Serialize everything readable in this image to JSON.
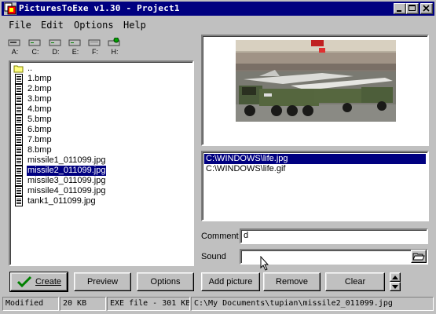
{
  "window": {
    "title": "PicturesToExe v1.30 - Project1"
  },
  "menu": {
    "items": [
      "File",
      "Edit",
      "Options",
      "Help"
    ]
  },
  "drives": [
    "A:",
    "C:",
    "D:",
    "E:",
    "F:",
    "H:"
  ],
  "files": [
    {
      "name": "..",
      "type": "folder"
    },
    {
      "name": "1.bmp",
      "type": "file"
    },
    {
      "name": "2.bmp",
      "type": "file"
    },
    {
      "name": "3.bmp",
      "type": "file"
    },
    {
      "name": "4.bmp",
      "type": "file"
    },
    {
      "name": "5.bmp",
      "type": "file"
    },
    {
      "name": "6.bmp",
      "type": "file"
    },
    {
      "name": "7.bmp",
      "type": "file"
    },
    {
      "name": "8.bmp",
      "type": "file"
    },
    {
      "name": "missile1_011099.jpg",
      "type": "file"
    },
    {
      "name": "missile2_011099.jpg",
      "type": "file",
      "selected": true
    },
    {
      "name": "missile3_011099.jpg",
      "type": "file"
    },
    {
      "name": "missile4_011099.jpg",
      "type": "file"
    },
    {
      "name": "tank1_011099.jpg",
      "type": "file"
    }
  ],
  "pictures": [
    {
      "path": "C:\\WINDOWS\\life.jpg",
      "selected": true
    },
    {
      "path": "C:\\WINDOWS\\life.gif",
      "selected": false
    }
  ],
  "comment": {
    "label": "Comment",
    "value": "d"
  },
  "sound": {
    "label": "Sound",
    "value": ""
  },
  "buttons": {
    "create": "Create",
    "preview": "Preview",
    "options": "Options",
    "add_picture": "Add picture",
    "remove": "Remove",
    "clear": "Clear"
  },
  "statusbar": {
    "state": "Modified",
    "size": "20 KB",
    "exe": "EXE file - 301 KB",
    "path": "C:\\My Documents\\tupian\\missile2_011099.jpg"
  },
  "colors": {
    "titlebar": "#000080",
    "selection": "#000080",
    "face": "#c0c0c0"
  }
}
